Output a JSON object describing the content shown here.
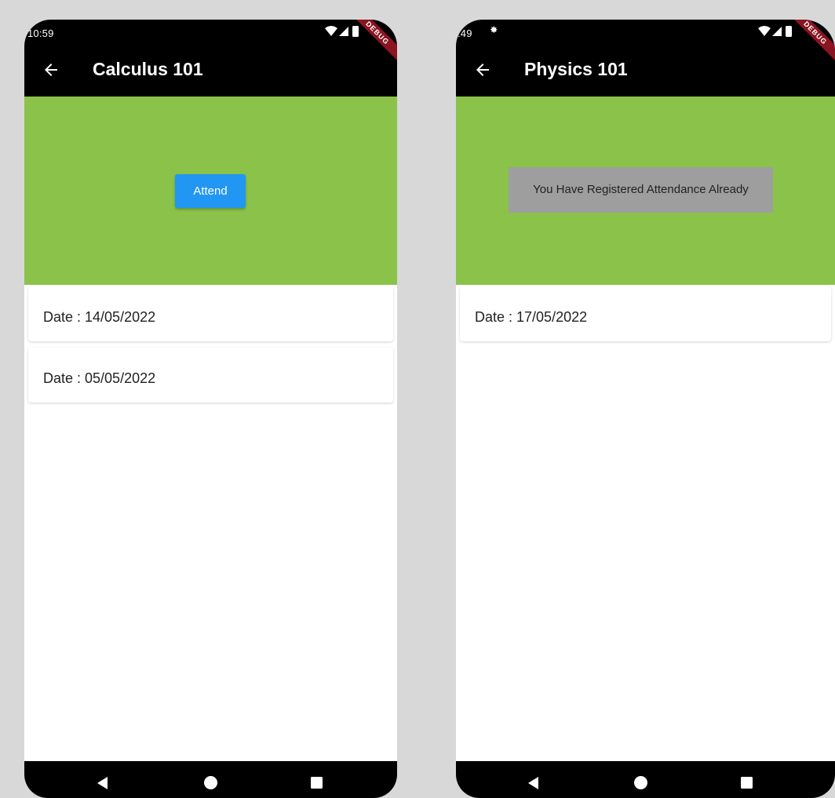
{
  "screens": [
    {
      "status_time": "10:59",
      "title": "Calculus 101",
      "debug_label": "DEBUG",
      "attend_label": "Attend",
      "sessions": [
        {
          "date_label": "Date : 14/05/2022"
        },
        {
          "date_label": "Date : 05/05/2022"
        }
      ]
    },
    {
      "status_time": ":49",
      "title": "Physics 101",
      "debug_label": "DEBUG",
      "already_label": "You Have Registered Attendance Already",
      "sessions": [
        {
          "date_label": "Date : 17/05/2022"
        }
      ]
    }
  ],
  "colors": {
    "app_bar": "#000000",
    "hero": "#8bc24a",
    "attend_button": "#2196f3",
    "already_box": "#9e9e9e",
    "debug_ribbon": "#8a1420"
  },
  "icons": [
    "back-arrow-icon",
    "wifi-icon",
    "signal-icon",
    "battery-icon",
    "settings-icon",
    "nav-back-icon",
    "nav-home-icon",
    "nav-recents-icon"
  ]
}
